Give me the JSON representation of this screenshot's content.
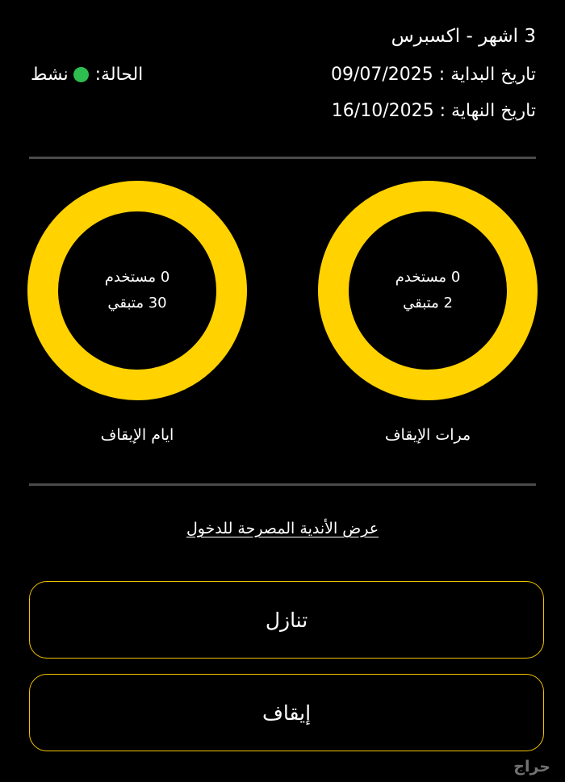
{
  "subscription": {
    "title": "3 اشهر - اكسبرس",
    "start_date": "تاريخ البداية : 09/07/2025",
    "end_date": "تاريخ النهاية : 16/10/2025",
    "status_label": "الحالة:",
    "status_value": "نشط",
    "status_color": "#2ebd4f"
  },
  "stats": {
    "freeze_times": {
      "used": "0 مستخدم",
      "remaining": "2 متبقي",
      "label": "مرات الإيقاف"
    },
    "freeze_days": {
      "used": "0 مستخدم",
      "remaining": "30 متبقي",
      "label": "ايام الإيقاف"
    },
    "ring_color": "#ffd200"
  },
  "links": {
    "allowed_clubs": "عرض الأندية المصرحة للدخول"
  },
  "buttons": {
    "transfer": "تنازل",
    "freeze": "إيقاف",
    "border_color": "#f2c200"
  },
  "watermark": "حراج"
}
